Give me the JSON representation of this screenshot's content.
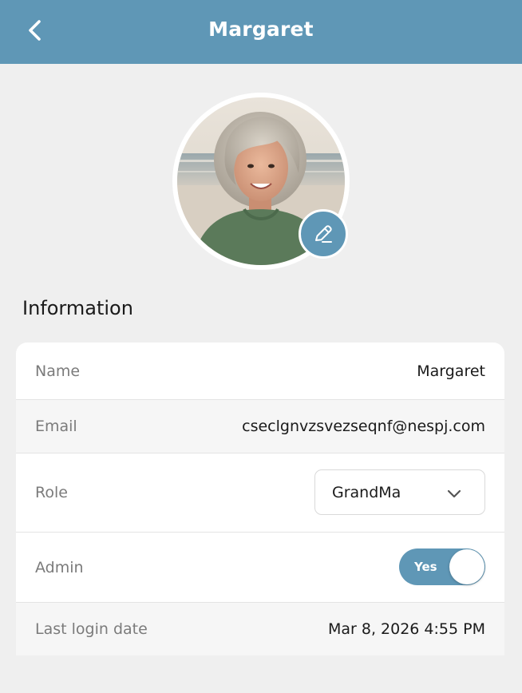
{
  "header": {
    "title": "Margaret",
    "back_icon": "chevron-left-icon",
    "color": "#5f97b6"
  },
  "profile": {
    "avatar": "user-profile-photo",
    "edit_icon": "pencil-icon"
  },
  "info": {
    "section_title": "Information",
    "rows": [
      {
        "label": "Name",
        "value": "Margaret"
      },
      {
        "label": "Email",
        "value": "cseclgnvzsvezseqnf@nespj.com"
      },
      {
        "label": "Role",
        "value": "GrandMa",
        "control": "dropdown"
      },
      {
        "label": "Admin",
        "value": "Yes",
        "control": "toggle",
        "enabled": true
      },
      {
        "label": "Last login date",
        "value": "Mar 8, 2026 4:55 PM"
      }
    ]
  }
}
